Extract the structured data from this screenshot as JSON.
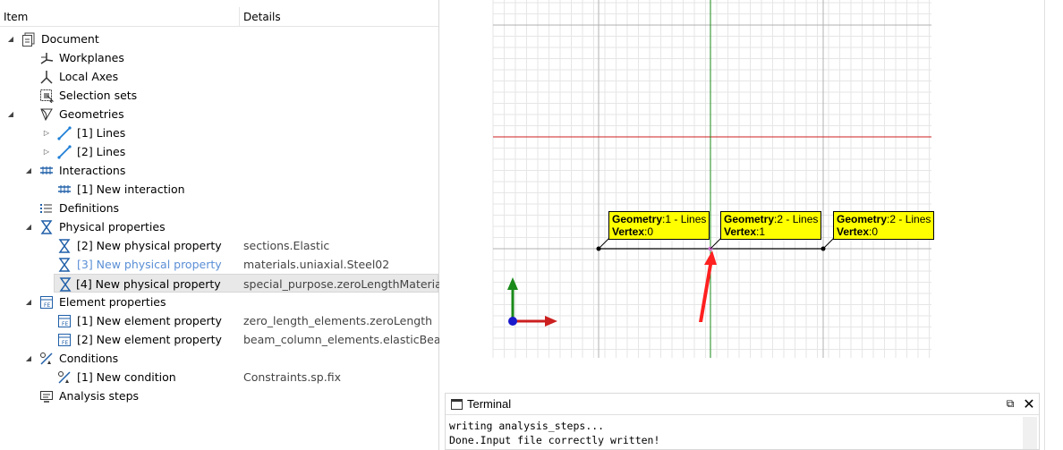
{
  "tree": {
    "columns": {
      "item": "Item",
      "details": "Details"
    },
    "rows": [
      {
        "label": "Document",
        "detail": ""
      },
      {
        "label": "Workplanes",
        "detail": ""
      },
      {
        "label": "Local Axes",
        "detail": ""
      },
      {
        "label": "Selection sets",
        "detail": ""
      },
      {
        "label": "Geometries",
        "detail": ""
      },
      {
        "label": "[1] Lines",
        "detail": ""
      },
      {
        "label": "[2] Lines",
        "detail": ""
      },
      {
        "label": "Interactions",
        "detail": ""
      },
      {
        "label": "[1] New interaction",
        "detail": ""
      },
      {
        "label": "Definitions",
        "detail": ""
      },
      {
        "label": "Physical properties",
        "detail": ""
      },
      {
        "label": "[2] New physical property",
        "detail": "sections.Elastic"
      },
      {
        "label": "[3] New physical property",
        "detail": "materials.uniaxial.Steel02"
      },
      {
        "label": "[4] New physical property",
        "detail": "special_purpose.zeroLengthMaterial"
      },
      {
        "label": "Element properties",
        "detail": ""
      },
      {
        "label": "[1] New element property",
        "detail": "zero_length_elements.zeroLength"
      },
      {
        "label": "[2] New element property",
        "detail": "beam_column_elements.elasticBea..."
      },
      {
        "label": "Conditions",
        "detail": ""
      },
      {
        "label": "[1] New condition",
        "detail": "Constraints.sp.fix"
      },
      {
        "label": "Analysis steps",
        "detail": ""
      }
    ]
  },
  "viewport": {
    "tooltips": [
      {
        "k1": "Geometry",
        "v1": ":1 - Lines",
        "k2": "Vertex",
        "v2": ":0"
      },
      {
        "k1": "Geometry",
        "v1": ":2 - Lines",
        "k2": "Vertex",
        "v2": ":1"
      },
      {
        "k1": "Geometry",
        "v1": ":2 - Lines",
        "k2": "Vertex",
        "v2": ":0"
      }
    ],
    "colors": {
      "x_axis": "#cc1f1f",
      "y_axis": "#1a8a1a",
      "z_axis": "#1a1acc",
      "tooltip_bg": "#ffff00",
      "annotation": "#ff2020"
    }
  },
  "terminal": {
    "title": "Terminal",
    "lines": [
      "writing analysis_steps...",
      "Done.Input file correctly written!"
    ],
    "restore_icon": "restore-icon",
    "close_icon": "close-icon"
  }
}
